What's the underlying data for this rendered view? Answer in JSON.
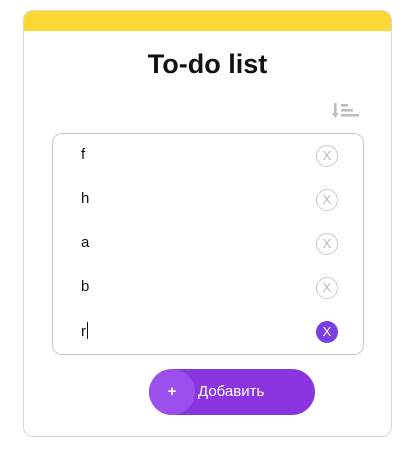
{
  "app": {
    "title": "To-do list",
    "accent_color": "#fdd835",
    "primary_color": "#8a35e0"
  },
  "toolbar": {
    "sort_icon": "sort-descending-icon"
  },
  "tasks": [
    {
      "text": "f",
      "delete_label": "X",
      "active": false
    },
    {
      "text": "h",
      "delete_label": "X",
      "active": false
    },
    {
      "text": "a",
      "delete_label": "X",
      "active": false
    },
    {
      "text": "b",
      "delete_label": "X",
      "active": false
    },
    {
      "text": "r",
      "delete_label": "X",
      "active": true
    }
  ],
  "add_button": {
    "icon": "+",
    "label": "Добавить"
  }
}
